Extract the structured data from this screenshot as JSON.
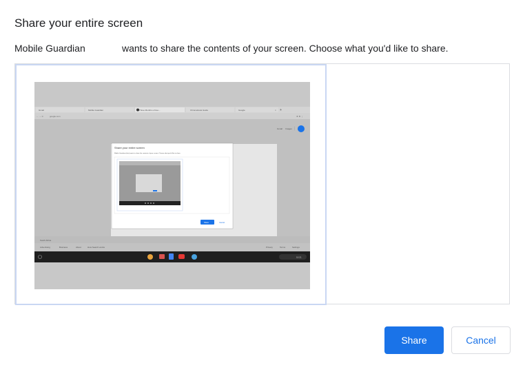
{
  "dialog": {
    "title": "Share your entire screen",
    "app_name": "Mobile Guardian",
    "message": "wants to share the contents of your screen. Choose what you'd like to share."
  },
  "buttons": {
    "share_label": "Share",
    "cancel_label": "Cancel"
  },
  "colors": {
    "accent": "#1a73e8",
    "selection_border": "#c9d7f3",
    "panel_border": "#dadce0"
  },
  "thumbnail": {
    "browser_tabs": [
      "Gmail",
      "Mobile Guardian",
      "Three Months a Free...",
      "Chromebook Guide",
      "Google"
    ],
    "address": "google.com",
    "header_links": [
      "Gmail",
      "Images"
    ],
    "footer_region": "South Africa",
    "footer_left_links": [
      "Advertising",
      "Business",
      "About",
      "How Search works"
    ],
    "footer_right_links": [
      "Privacy",
      "Terms",
      "Settings"
    ],
    "inner_dialog_title": "Share your entire screen",
    "inner_dialog_message": "Mobile Guardian (dev) wants to share the contents of your screen. Choose what you'd like to share.",
    "inner_share": "Share",
    "inner_cancel": "Cancel",
    "clock": "10:21"
  }
}
